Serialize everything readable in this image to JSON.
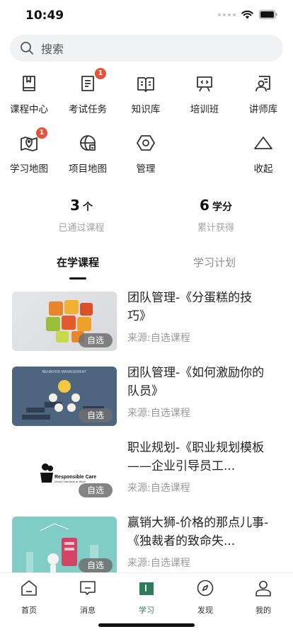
{
  "status": {
    "time": "10:49"
  },
  "search": {
    "placeholder": "搜索"
  },
  "grid": [
    {
      "label": "课程中心",
      "icon": "course-center-icon",
      "badge": ""
    },
    {
      "label": "考试任务",
      "icon": "exam-task-icon",
      "badge": "1"
    },
    {
      "label": "知识库",
      "icon": "knowledge-base-icon",
      "badge": ""
    },
    {
      "label": "培训班",
      "icon": "training-class-icon",
      "badge": ""
    },
    {
      "label": "讲师库",
      "icon": "lecturer-icon",
      "badge": ""
    },
    {
      "label": "学习地图",
      "icon": "learning-map-icon",
      "badge": "1"
    },
    {
      "label": "项目地图",
      "icon": "project-map-icon",
      "badge": ""
    },
    {
      "label": "管理",
      "icon": "manage-hexagon-icon",
      "badge": ""
    },
    {
      "label": "收起",
      "icon": "collapse-triangle-icon",
      "badge": ""
    }
  ],
  "stats": [
    {
      "value": "3",
      "unit": "个",
      "desc": "已通过课程"
    },
    {
      "value": "6",
      "unit": "学分",
      "desc": "累计获得"
    }
  ],
  "tabs": [
    {
      "label": "在学课程",
      "active": true
    },
    {
      "label": "学习计划",
      "active": false
    }
  ],
  "courses": [
    {
      "title": "团队管理-《分蛋糕的技巧》",
      "source": "来源:自选课程",
      "tag": "自选",
      "thumb": "puzzle"
    },
    {
      "title": "团队管理-《如何激励你的队员》",
      "source": "来源:自选课程",
      "tag": "自选",
      "thumb": "bulbs"
    },
    {
      "title": "职业规划-《职业规划模板——企业引导员工...",
      "source": "来源:自选课程",
      "tag": "自选",
      "thumb": "logo"
    },
    {
      "title": "赢销大狮-价格的那点儿事-《独裁者的致命失...",
      "source": "来源:自选课程",
      "tag": "自选",
      "thumb": "teal"
    }
  ],
  "thumb_text": {
    "bulbs_banner": "BEHAVIOR MANAGEMENT",
    "logo_name": "Responsible Care",
    "logo_tagline": "Good Chemistry at Work"
  },
  "tabbar": [
    {
      "label": "首页",
      "icon": "home-icon",
      "active": false
    },
    {
      "label": "消息",
      "icon": "message-icon",
      "active": false
    },
    {
      "label": "学习",
      "icon": "study-book-icon",
      "active": true
    },
    {
      "label": "发现",
      "icon": "discover-compass-icon",
      "active": false
    },
    {
      "label": "我的",
      "icon": "profile-icon",
      "active": false
    }
  ],
  "colors": {
    "accent": "#2e7d5a",
    "badge": "#e94f3a",
    "icon_stroke": "#333333"
  }
}
